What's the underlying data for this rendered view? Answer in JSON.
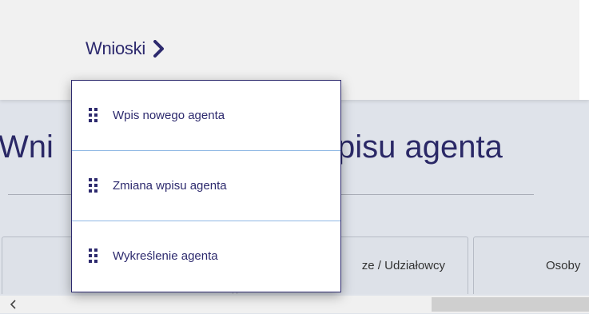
{
  "header": {
    "nav_label": "Wnioski",
    "chevron_icon": "chevron-right-icon"
  },
  "page": {
    "title_visible_left": "Wni",
    "title_visible_right": "pisu agenta"
  },
  "tabs": [
    {
      "label": ""
    },
    {
      "label": "ze / Udziałowcy"
    },
    {
      "label": "Osoby"
    }
  ],
  "dropdown": {
    "items": [
      {
        "label": "Wpis nowego agenta",
        "icon": "grip-icon"
      },
      {
        "label": "Zmiana wpisu agenta",
        "icon": "grip-icon"
      },
      {
        "label": "Wykreślenie agenta",
        "icon": "grip-icon"
      }
    ]
  },
  "scrollbar": {
    "left_icon": "chevron-left-icon"
  },
  "colors": {
    "brand": "#2d2a6e",
    "divider": "#8fb8e4",
    "background": "#dfe3ea"
  }
}
